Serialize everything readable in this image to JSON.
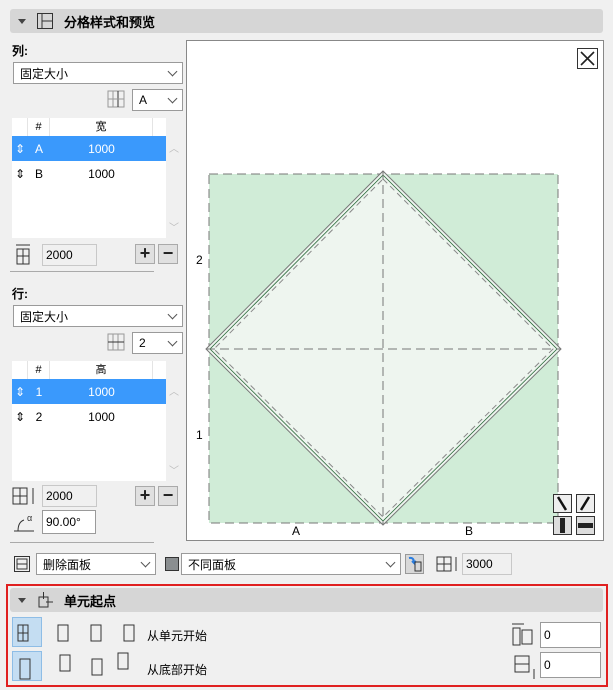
{
  "section1": {
    "title": "分格样式和预览"
  },
  "columns": {
    "label": "列:",
    "mode": "固定大小",
    "selector": "A",
    "headers": [
      "#",
      "宽"
    ],
    "rows": [
      {
        "id": "A",
        "value": "1000",
        "selected": true
      },
      {
        "id": "B",
        "value": "1000",
        "selected": false
      }
    ],
    "total": "2000"
  },
  "rows": {
    "label": "行:",
    "mode": "固定大小",
    "selector": "2",
    "headers": [
      "#",
      "高"
    ],
    "rows": [
      {
        "id": "1",
        "value": "1000",
        "selected": true
      },
      {
        "id": "2",
        "value": "1000",
        "selected": false
      }
    ],
    "total": "2000",
    "angle": "90.00°"
  },
  "preview": {
    "row_labels": [
      "2",
      "1"
    ],
    "col_labels": [
      "A",
      "B"
    ],
    "fill": "#d0ecd7"
  },
  "bottom": {
    "panel_action": "删除面板",
    "panel_type": "不同面板",
    "height": "3000"
  },
  "section2": {
    "title": "单元起点",
    "from_cell": "从单元开始",
    "from_bottom": "从底部开始",
    "offset_x": "0",
    "offset_y": "0"
  },
  "colors": {
    "highlight": "#3a99fc",
    "outline": "#e02020"
  }
}
